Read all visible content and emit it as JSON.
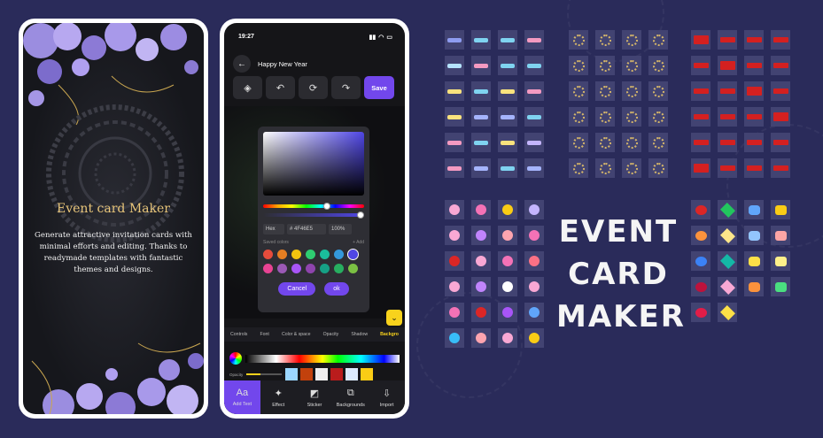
{
  "colors": {
    "background": "#2a2b5a",
    "accent": "#7247ec",
    "gold": "#e9c67a",
    "highlight": "#f8d21c",
    "cell": "#424372"
  },
  "left_card": {
    "title": "Event card Maker",
    "description": "Generate attractive invitation cards with minimal efforts and editing. Thanks to readymade templates with fantastic themes and designs."
  },
  "editor": {
    "status_time": "19:27",
    "title": "Happy New Year",
    "save_label": "Save",
    "toolbar_icons": [
      "layers-icon",
      "undo-icon",
      "rotate-icon",
      "redo-icon"
    ],
    "picker": {
      "mode": "Hex",
      "hex_value": "# 4F46E5",
      "opacity_value": "100%",
      "saved_label": "Saved colors",
      "add_label": "+ Add",
      "swatches": [
        "#e74c3c",
        "#e67e22",
        "#f1c40f",
        "#2ecc71",
        "#1abc9c",
        "#3498db",
        "#4f46e5",
        "#e84393",
        "#9b59b6",
        "#a855f7",
        "#8e44ad",
        "#16a085",
        "#27ae60",
        "#7bc043"
      ],
      "cancel_label": "Cancel",
      "ok_label": "ok"
    },
    "tabs": [
      "Controls",
      "Font",
      "Color & space",
      "Opacity",
      "Shadow",
      "Backgro"
    ],
    "opacity_label": "Opacity",
    "bottom_nav": [
      {
        "label": "Add Text",
        "icon": "text-icon"
      },
      {
        "label": "Effect",
        "icon": "wand-icon"
      },
      {
        "label": "Sticker",
        "icon": "sticker-icon"
      },
      {
        "label": "Backgrounds",
        "icon": "backgrounds-icon"
      },
      {
        "label": "Import",
        "icon": "import-icon"
      }
    ]
  },
  "promo": {
    "line1": "EVENT",
    "line2": "CARD",
    "line3": "MAKER"
  }
}
